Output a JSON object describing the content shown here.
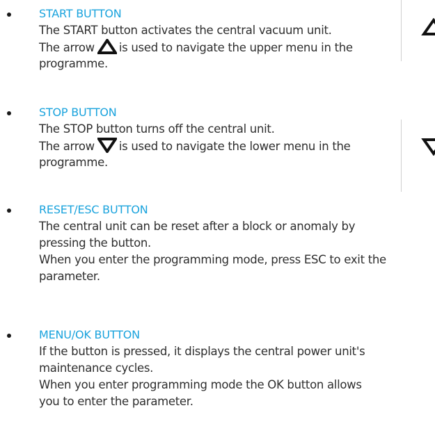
{
  "sections": [
    {
      "title": "START BUTTON",
      "lines": [
        "The START button activates the central vacuum unit.",
        "The arrow",
        "is used to navigate the upper menu in the",
        "programme."
      ],
      "icon": "up-triangle-icon"
    },
    {
      "title": "STOP BUTTON",
      "lines": [
        "The STOP button turns off the central unit.",
        "The arrow",
        "is used to navigate the lower menu in the",
        "programme."
      ],
      "icon": "down-triangle-icon"
    },
    {
      "title": "RESET/ESC BUTTON",
      "lines": [
        "The central unit can be reset after a block or anomaly by",
        "pressing the button.",
        "When you enter the programming mode, press ESC to exit the",
        "parameter."
      ]
    },
    {
      "title": "MENU/OK BUTTON",
      "lines": [
        "If the button is pressed, it displays the central power unit's",
        "maintenance cycles.",
        "When you enter programming mode the OK button allows",
        "you to enter the parameter."
      ]
    }
  ],
  "colors": {
    "heading": "#1aa3dd",
    "text": "#2e2e2e"
  }
}
